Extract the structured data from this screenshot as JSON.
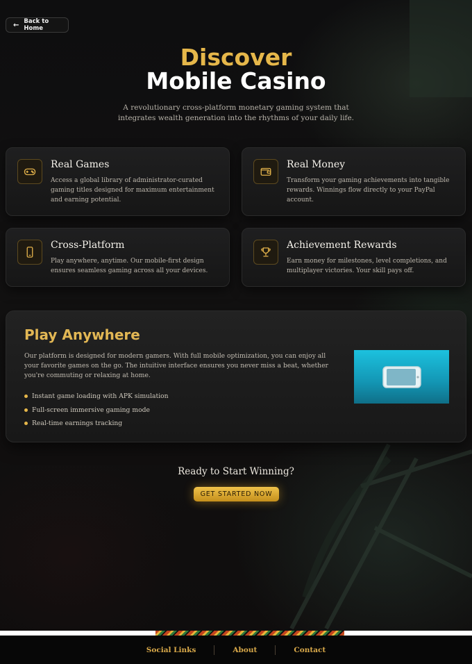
{
  "back_button": {
    "label": "Back to Home",
    "icon": "arrow-left-icon"
  },
  "hero": {
    "title_line1": "Discover",
    "title_line2": "Mobile Casino",
    "subtitle": "A revolutionary cross-platform monetary gaming system that integrates wealth generation into the rhythms of your daily life."
  },
  "features": [
    {
      "icon": "gamepad-icon",
      "title": "Real Games",
      "description": "Access a global library of administrator-curated gaming titles designed for maximum entertainment and earning potential."
    },
    {
      "icon": "wallet-icon",
      "title": "Real Money",
      "description": "Transform your gaming achievements into tangible rewards. Winnings flow directly to your PayPal account."
    },
    {
      "icon": "smartphone-icon",
      "title": "Cross-Platform",
      "description": "Play anywhere, anytime. Our mobile-first design ensures seamless gaming across all your devices."
    },
    {
      "icon": "trophy-icon",
      "title": "Achievement Rewards",
      "description": "Earn money for milestones, level completions, and multiplayer victories. Your skill pays off."
    }
  ],
  "play_anywhere": {
    "title": "Play Anywhere",
    "description": "Our platform is designed for modern gamers. With full mobile optimization, you can enjoy all your favorite games on the go. The intuitive interface ensures you never miss a beat, whether you're commuting or relaxing at home.",
    "bullets": [
      "Instant game loading with APK simulation",
      "Full-screen immersive gaming mode",
      "Real-time earnings tracking"
    ],
    "image_icon": "phone-landscape-icon"
  },
  "cta": {
    "heading": "Ready to Start Winning?",
    "button_label": "GET STARTED NOW"
  },
  "footer": {
    "links": [
      "Social Links",
      "About",
      "Contact"
    ]
  },
  "colors": {
    "accent_gold": "#e6b74a",
    "background": "#0b0b0c",
    "card": "#1c1c1d",
    "phone_panel": "#1ab3d0"
  }
}
